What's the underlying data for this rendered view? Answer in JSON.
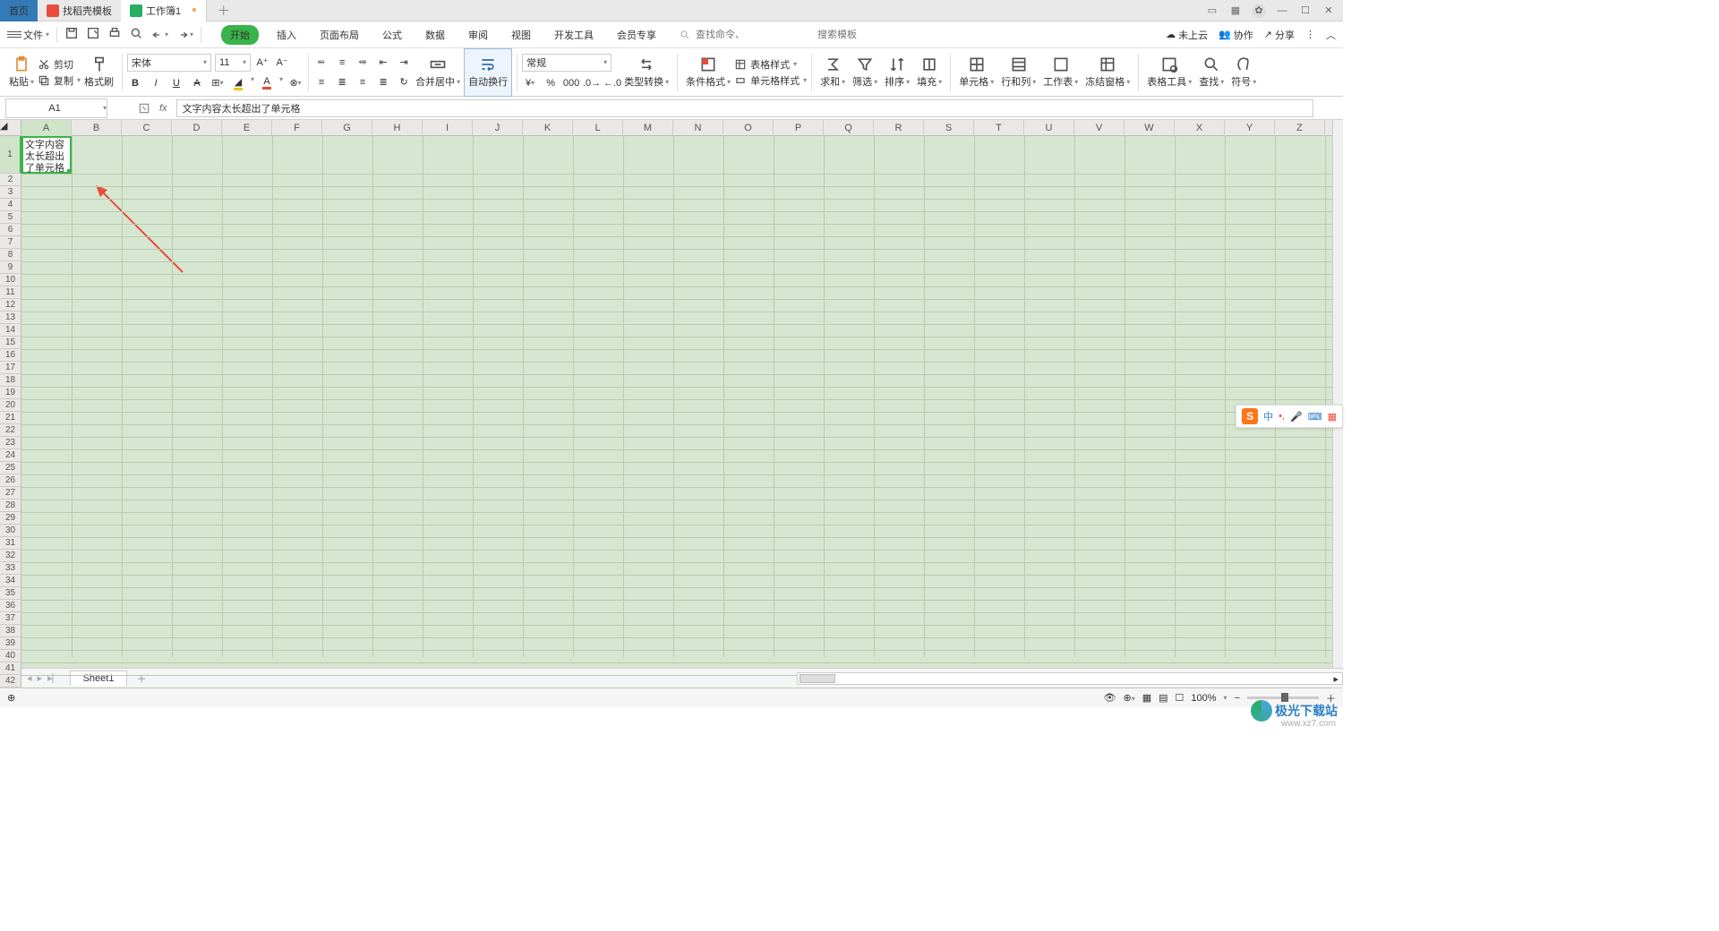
{
  "tabs": {
    "home": "首页",
    "templates": "找稻壳模板",
    "workbook": "工作簿1"
  },
  "file_menu": "文件",
  "menu": {
    "start": "开始",
    "insert": "插入",
    "layout": "页面布局",
    "formula": "公式",
    "data": "数据",
    "review": "审阅",
    "view": "视图",
    "dev": "开发工具",
    "vip": "会员专享"
  },
  "search": {
    "cmd_ph": "查找命令、",
    "tpl_ph": "搜索模板"
  },
  "topright": {
    "cloud": "未上云",
    "collab": "协作",
    "share": "分享"
  },
  "ribbon": {
    "paste": "粘贴",
    "cut": "剪切",
    "copy": "复制",
    "fmtpaint": "格式刷",
    "font": "宋体",
    "size": "11",
    "merge": "合并居中",
    "wrap": "自动换行",
    "numfmt": "常规",
    "typeconv": "类型转换",
    "condfmt": "条件格式",
    "tablestyle": "表格样式",
    "cellstyle": "单元格样式",
    "sum": "求和",
    "filter": "筛选",
    "sort": "排序",
    "fill": "填充",
    "cell": "单元格",
    "rowcol": "行和列",
    "sheet": "工作表",
    "freeze": "冻结窗格",
    "tabletool": "表格工具",
    "find": "查找",
    "symbol": "符号"
  },
  "namebox": "A1",
  "formula": "文字内容太长超出了单元格",
  "cell_a1": "文字内容太长超出了单元格",
  "cols": [
    "A",
    "B",
    "C",
    "D",
    "E",
    "F",
    "G",
    "H",
    "I",
    "J",
    "K",
    "L",
    "M",
    "N",
    "O",
    "P",
    "Q",
    "R",
    "S",
    "T",
    "U",
    "V",
    "W",
    "X",
    "Y",
    "Z"
  ],
  "sheet": "Sheet1",
  "ime": {
    "lang": "中"
  },
  "zoom": "100%",
  "watermark": {
    "name": "极光下载站",
    "url": "www.xz7.com"
  }
}
